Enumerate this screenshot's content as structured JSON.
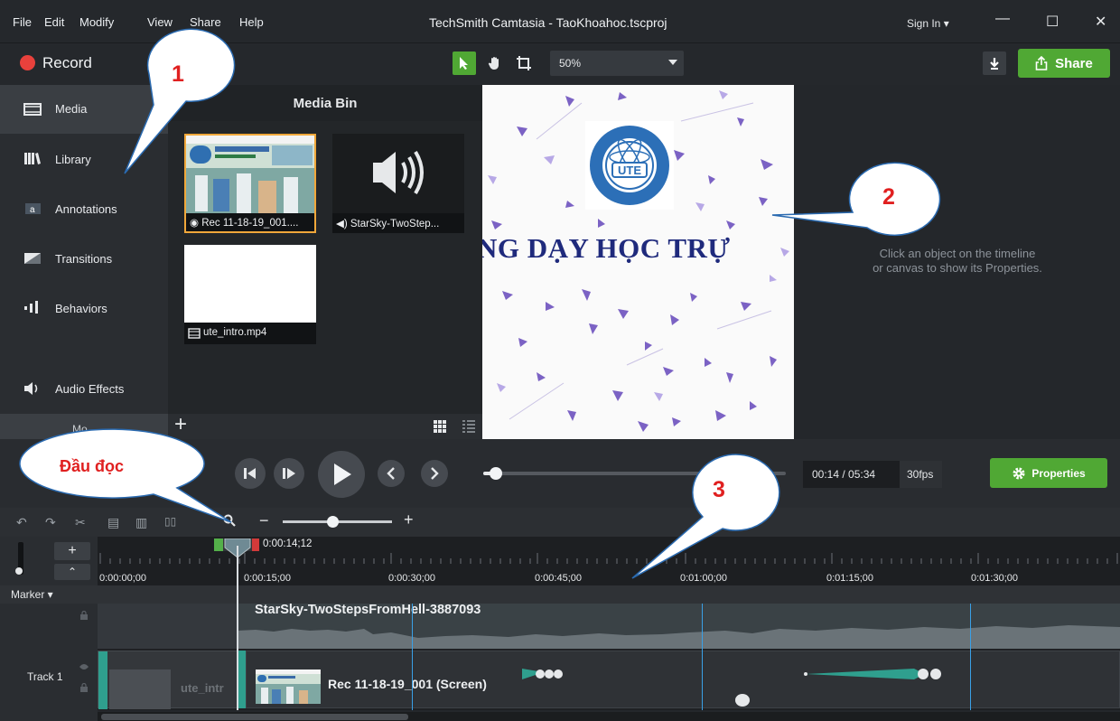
{
  "menu": {
    "file": "File",
    "edit": "Edit",
    "modify": "Modify",
    "view": "View",
    "share": "Share",
    "help": "Help"
  },
  "window": {
    "title": "TechSmith Camtasia - TaoKhoahoc.tscproj",
    "sign_in": "Sign In ▾",
    "minimize": "—",
    "maximize": "☐",
    "close": "✕"
  },
  "toolbar": {
    "record_label": "Record",
    "zoom_value": "50%",
    "share_label": "Share",
    "accent_color": "#50a834"
  },
  "sidebar": {
    "items": [
      {
        "label": "Media",
        "icon": "film-icon"
      },
      {
        "label": "Library",
        "icon": "books-icon"
      },
      {
        "label": "Annotations",
        "icon": "annotation-icon"
      },
      {
        "label": "Transitions",
        "icon": "transition-icon"
      },
      {
        "label": "Behaviors",
        "icon": "behaviors-icon"
      },
      {
        "label": "Audio Effects",
        "icon": "speaker-icon"
      }
    ],
    "bottom_label": "Mo"
  },
  "media_bin": {
    "title": "Media Bin",
    "items": [
      {
        "caption": "◉ Rec 11-18-19_001....",
        "type": "screen-recording"
      },
      {
        "caption": "◀) StarSky-TwoStep...",
        "type": "audio"
      },
      {
        "caption": "ute_intro.mp4",
        "type": "video"
      }
    ]
  },
  "canvas": {
    "banner_text": "NG DẠY HỌC TRỰ",
    "logo_text": "UTE"
  },
  "properties": {
    "hint_line1": "Click an object on the timeline",
    "hint_line2": "or canvas to show its Properties.",
    "button_label": "Properties"
  },
  "playback": {
    "time": "00:14 / 05:34",
    "fps": "30fps",
    "progress": 0.04
  },
  "timeline": {
    "playhead_time": "0:00:14;12",
    "ruler_labels": [
      "0:00:00;00",
      "0:00:15;00",
      "0:00:30;00",
      "0:00:45;00",
      "0:01:00;00",
      "0:01:15;00",
      "0:01:30;00"
    ],
    "marker_label": "Marker ▾",
    "track1_label": "Track 1",
    "audio_clip_title": "StarSky-TwoStepsFromHell-3887093",
    "intro_clip_title": "ute_intr",
    "rec_clip_title": "Rec 11-18-19_001 (Screen)"
  },
  "annotations": {
    "callout_1": "1",
    "callout_2": "2",
    "callout_3": "3",
    "reader_label": "Đầu đọc"
  }
}
